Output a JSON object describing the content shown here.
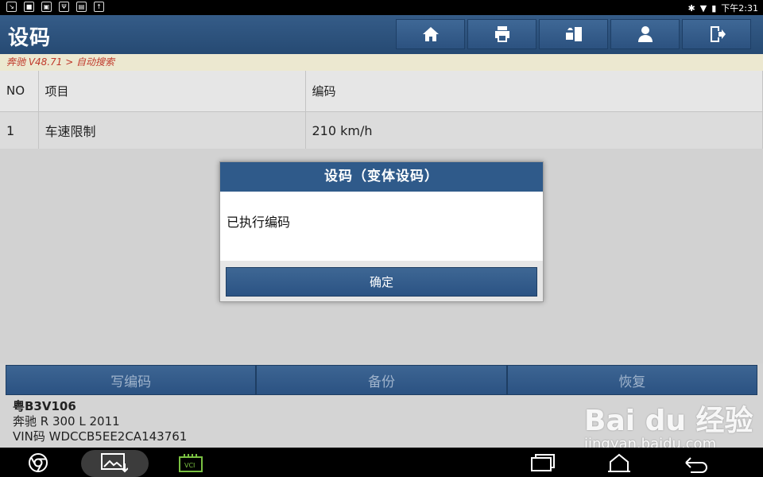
{
  "statusbar": {
    "time": "下午2:31"
  },
  "header": {
    "title": "设码"
  },
  "breadcrumb": "奔驰 V48.71 > 自动搜索",
  "table": {
    "headers": {
      "no": "NO",
      "item": "项目",
      "code": "编码"
    },
    "rows": [
      {
        "no": "1",
        "item": "车速限制",
        "code": "210 km/h"
      }
    ]
  },
  "dialog": {
    "title": "设码（变体设码）",
    "message": "已执行编码",
    "ok_label": "确定"
  },
  "actions": {
    "write": "写编码",
    "backup": "备份",
    "restore": "恢复"
  },
  "vehicle": {
    "plate": "粤B3V106",
    "model": "奔驰 R 300 L 2011",
    "vin": "VIN码 WDCCB5EE2CA143761"
  },
  "watermark": {
    "logo": "Bai du 经验",
    "url": "jingyan.baidu.com"
  },
  "nav": {
    "vci_label": "VCI"
  },
  "colors": {
    "header_blue": "#2f5a8a",
    "breadcrumb_red": "#c0392b"
  }
}
